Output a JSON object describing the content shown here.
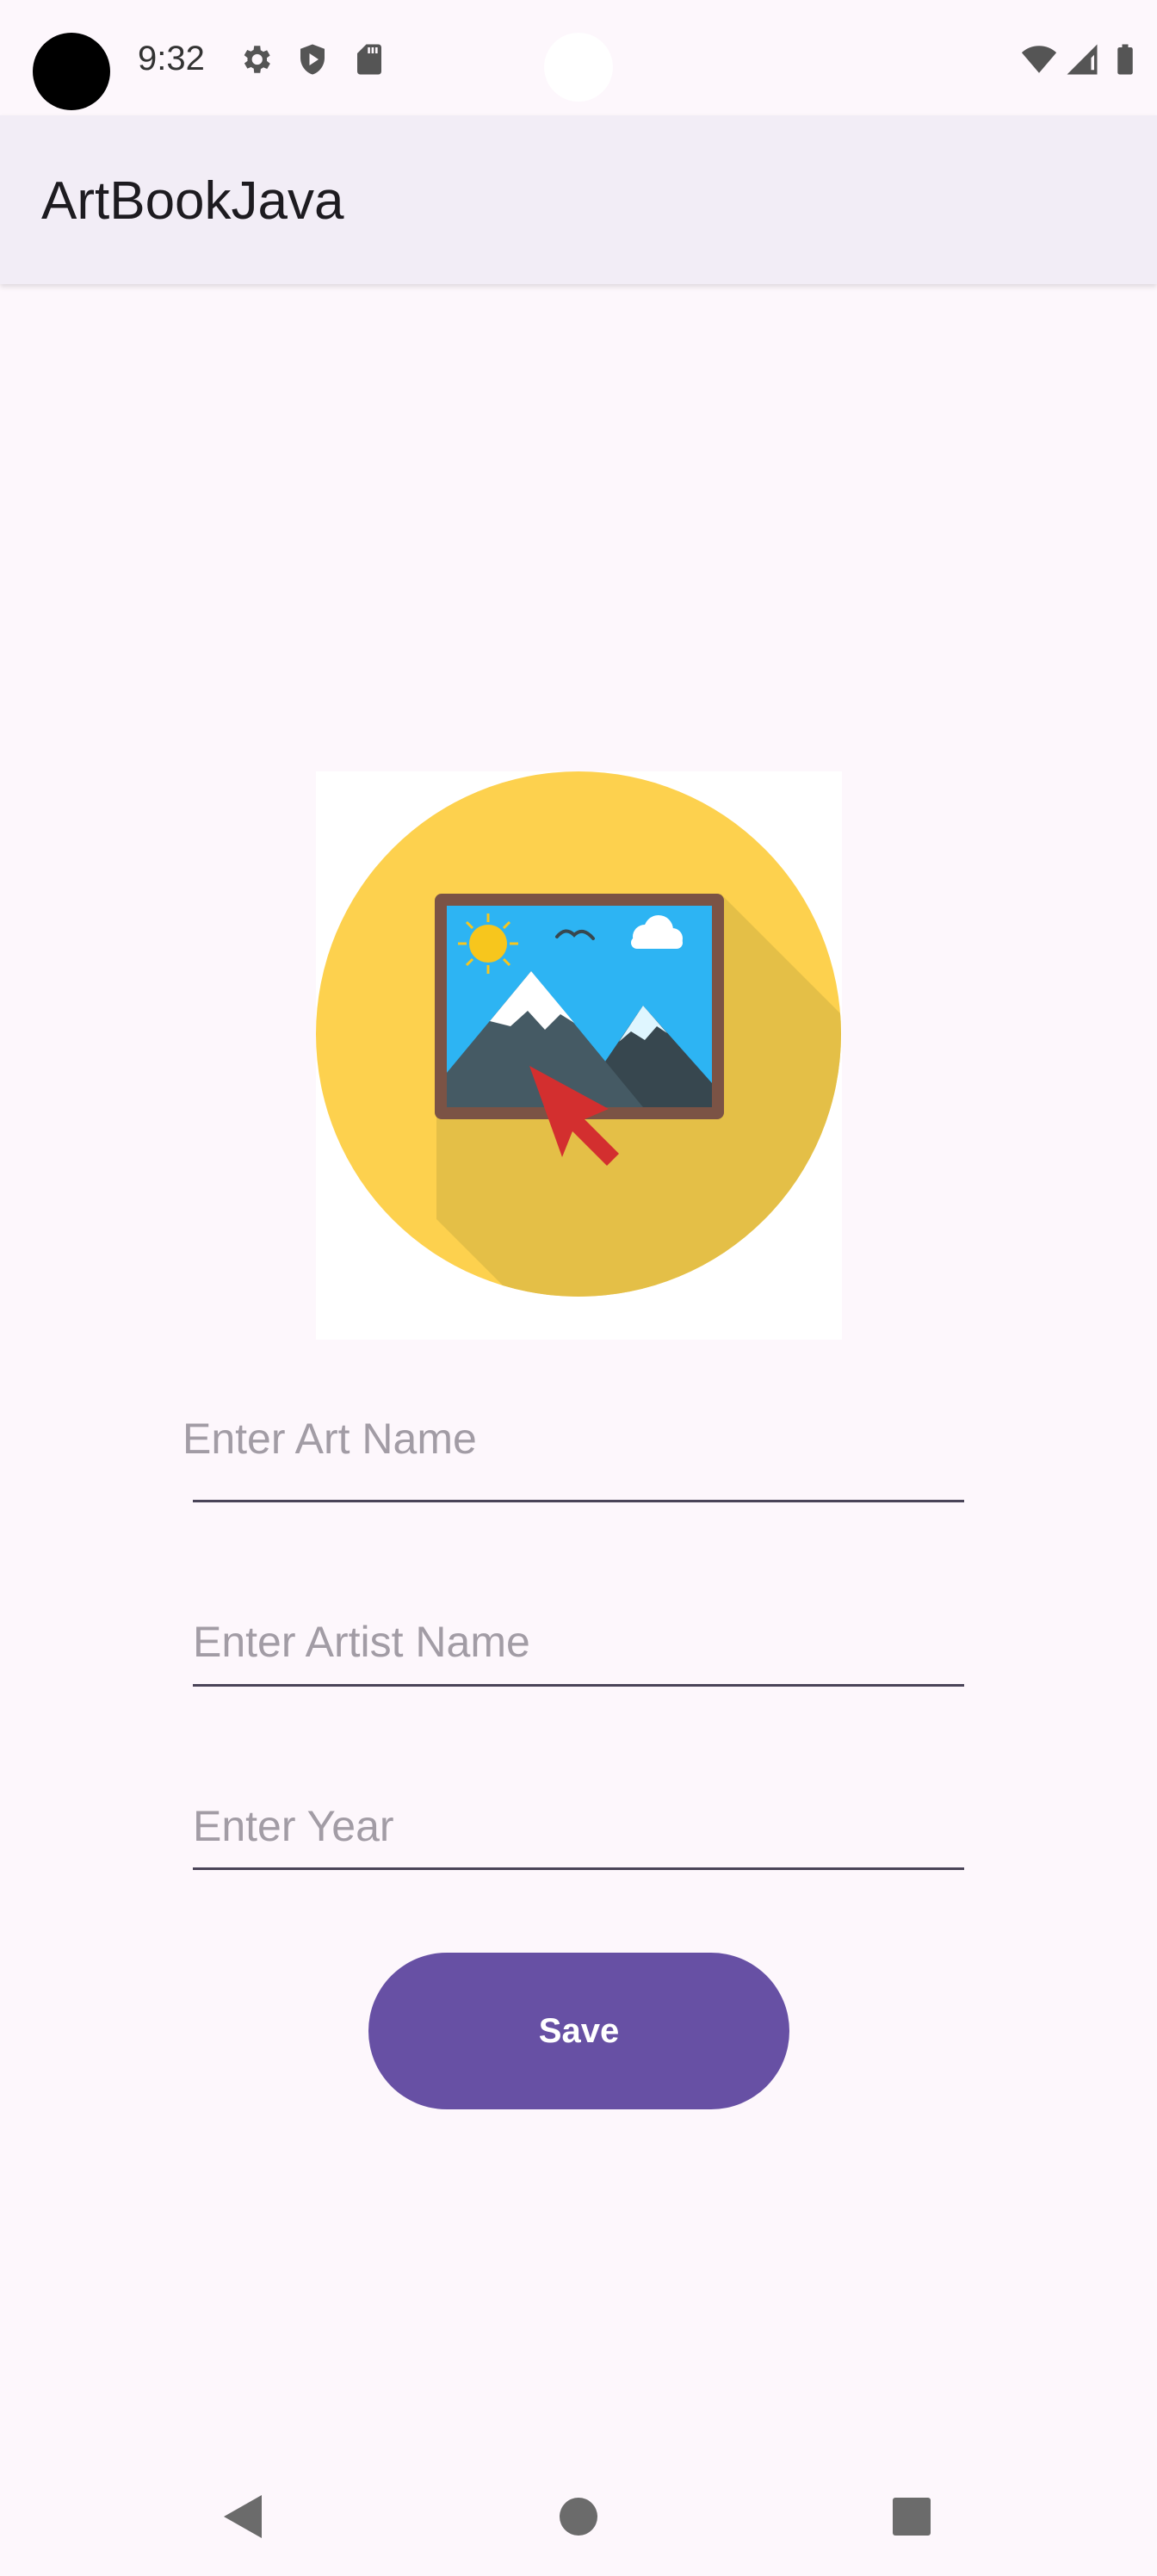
{
  "status_bar": {
    "time": "9:32",
    "left_icons": [
      "gear-icon",
      "shield-play-icon",
      "sd-card-icon"
    ],
    "right_icons": [
      "wifi-icon",
      "cell-signal-icon",
      "battery-icon"
    ]
  },
  "app_bar": {
    "title": "ArtBookJava"
  },
  "image": {
    "icon": "add-image-icon",
    "alt": ""
  },
  "form": {
    "art_name": {
      "placeholder": "Enter Art Name",
      "value": ""
    },
    "artist_name": {
      "placeholder": "Enter Artist Name",
      "value": ""
    },
    "year": {
      "placeholder": "Enter Year",
      "value": ""
    },
    "save_label": "Save"
  },
  "nav_bar": {
    "buttons": [
      "back-icon",
      "home-icon",
      "recents-icon"
    ]
  },
  "colors": {
    "accent": "#6750a4",
    "background": "#fdf7fc",
    "app_bar": "#f2edf6"
  }
}
